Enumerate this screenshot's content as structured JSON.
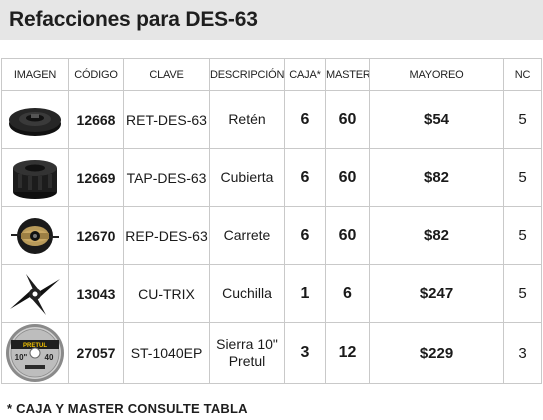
{
  "title": "Refacciones para DES-63",
  "columns": [
    "IMAGEN",
    "CÓDIGO",
    "CLAVE",
    "DESCRIPCIÓN",
    "CAJA*",
    "MASTER",
    "MAYOREO",
    "NC"
  ],
  "rows": [
    {
      "image": "retainer-ring-icon",
      "codigo": "12668",
      "clave": "RET-DES-63",
      "descripcion": "Retén",
      "caja": "6",
      "master": "60",
      "mayoreo": "$54",
      "nc": "5"
    },
    {
      "image": "spool-cover-icon",
      "codigo": "12669",
      "clave": "TAP-DES-63",
      "descripcion": "Cubierta",
      "caja": "6",
      "master": "60",
      "mayoreo": "$82",
      "nc": "5"
    },
    {
      "image": "line-spool-icon",
      "codigo": "12670",
      "clave": "REP-DES-63",
      "descripcion": "Carrete",
      "caja": "6",
      "master": "60",
      "mayoreo": "$82",
      "nc": "5"
    },
    {
      "image": "tri-blade-icon",
      "codigo": "13043",
      "clave": "CU-TRIX",
      "descripcion": "Cuchilla",
      "caja": "1",
      "master": "6",
      "mayoreo": "$247",
      "nc": "5"
    },
    {
      "image": "saw-blade-icon",
      "codigo": "27057",
      "clave": "ST-1040EP",
      "descripcion_line1": "Sierra 10\"",
      "descripcion_line2": "Pretul",
      "caja": "3",
      "master": "12",
      "mayoreo": "$229",
      "nc": "3",
      "image_text": {
        "brand": "PRETUL",
        "size": "10\"",
        "teeth": "40"
      }
    }
  ],
  "footnote": "* CAJA Y MASTER CONSULTE TABLA"
}
